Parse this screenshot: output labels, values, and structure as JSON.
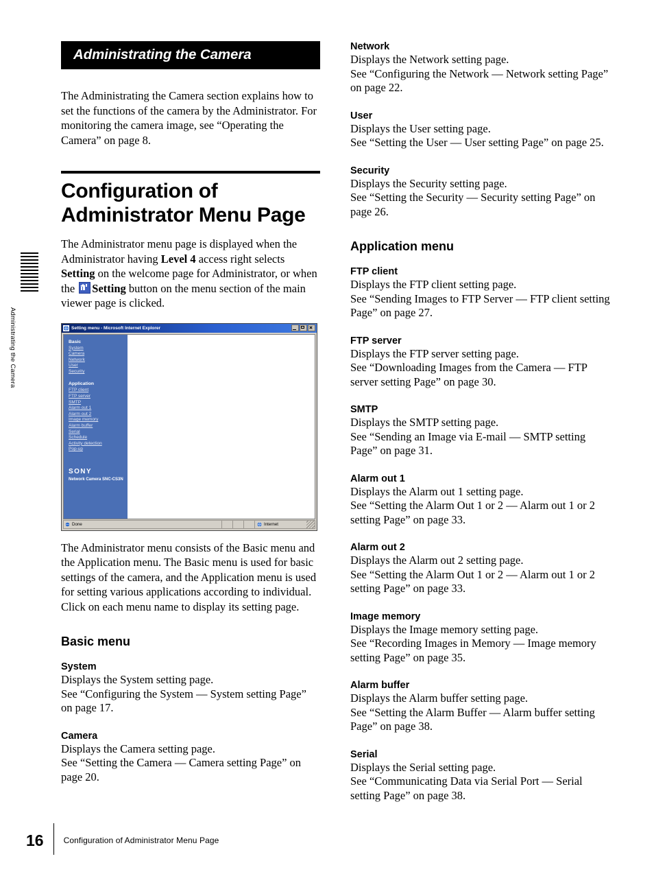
{
  "side_tab": {
    "vertical_label": "Administrating the Camera"
  },
  "banner": {
    "title": "Administrating the Camera"
  },
  "intro": {
    "paragraph": "The Administrating the Camera section explains how to set the functions of the camera by the Administrator. For monitoring the camera image, see “Operating the Camera” on page 8."
  },
  "page_title": "Configuration of Administrator Menu Page",
  "lead_paragraph": {
    "part1": "The Administrator menu page is displayed when the Administrator having ",
    "bold1": "Level 4",
    "part2": " access right selects ",
    "bold2": "Setting",
    "part3": " on the welcome page for Administrator, or when the ",
    "bold3": "Setting",
    "part4": " button on the menu section of the main viewer page is clicked."
  },
  "figure": {
    "window_title": "Setting menu - Microsoft Internet Explorer",
    "basic_group_label": "Basic",
    "basic_links": [
      "System",
      "Camera",
      "Network",
      "User",
      "Security"
    ],
    "application_group_label": "Application",
    "application_links": [
      "FTP client",
      "FTP server",
      "SMTP",
      "Alarm out 1",
      "Alarm out 2",
      "Image memory",
      "Alarm buffer",
      "Serial",
      "Schedule",
      "Activity detection",
      "Pop-up"
    ],
    "logo": "SONY",
    "model": "Network Camera SNC-CS3N",
    "status_left": "Done",
    "status_zone": "Internet",
    "sidebar_color": "#4a6fb5",
    "titlebar_color": "#0a246a"
  },
  "after_figure_paragraph": "The Administrator menu consists of the Basic menu and the Application menu.  The Basic menu is used for basic settings of the camera, and the Application menu is used for setting various applications according to individual. Click on each menu name to display its setting page.",
  "sections": {
    "basic_menu_heading": "Basic menu",
    "application_menu_heading": "Application menu"
  },
  "entries_left": [
    {
      "title": "System",
      "line1": "Displays the System setting page.",
      "line2": "See “Configuring the System — System setting Page” on page 17."
    },
    {
      "title": "Camera",
      "line1": "Displays the Camera setting page.",
      "line2": "See “Setting the Camera — Camera setting Page” on page 20."
    }
  ],
  "entries_right_basic": [
    {
      "title": "Network",
      "line1": "Displays the Network setting page.",
      "line2": "See “Configuring the Network — Network setting Page” on page 22."
    },
    {
      "title": "User",
      "line1": "Displays the User setting page.",
      "line2": "See “Setting the User — User setting Page” on page 25."
    },
    {
      "title": "Security",
      "line1": "Displays the Security setting page.",
      "line2": "See “Setting the Security — Security setting Page” on page 26."
    }
  ],
  "entries_right_application": [
    {
      "title": "FTP client",
      "line1": "Displays the FTP client setting page.",
      "line2": "See “Sending Images to FTP Server — FTP client setting Page” on page 27."
    },
    {
      "title": "FTP server",
      "line1": "Displays the FTP server setting page.",
      "line2": "See “Downloading Images from the Camera — FTP server setting Page” on page 30."
    },
    {
      "title": "SMTP",
      "line1": "Displays the SMTP setting page.",
      "line2": "See “Sending an Image via E-mail — SMTP setting Page” on page 31."
    },
    {
      "title": "Alarm out 1",
      "line1": "Displays the Alarm out 1 setting page.",
      "line2": "See “Setting the Alarm Out 1 or 2 — Alarm out 1 or 2 setting Page” on page 33."
    },
    {
      "title": "Alarm out 2",
      "line1": "Displays the Alarm out 2 setting page.",
      "line2": "See “Setting the Alarm Out 1 or 2 — Alarm out 1 or 2 setting Page” on page 33."
    },
    {
      "title": "Image memory",
      "line1": "Displays the Image memory setting page.",
      "line2": "See “Recording Images in Memory — Image memory setting Page” on page 35."
    },
    {
      "title": "Alarm buffer",
      "line1": "Displays the Alarm buffer setting page.",
      "line2": "See “Setting the Alarm Buffer — Alarm buffer setting Page” on page 38."
    },
    {
      "title": "Serial",
      "line1": "Displays the Serial setting page.",
      "line2": "See “Communicating Data via Serial Port — Serial setting Page” on page 38."
    }
  ],
  "footer": {
    "page_number": "16",
    "running_title": "Configuration of Administrator Menu Page"
  }
}
